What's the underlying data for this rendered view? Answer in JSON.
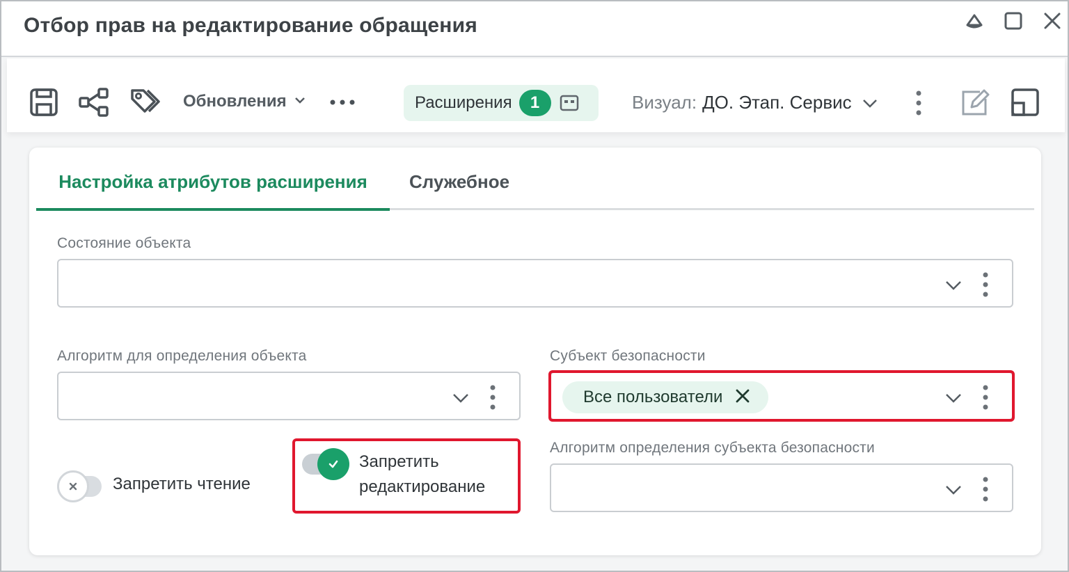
{
  "window": {
    "title": "Отбор прав на редактирование обращения",
    "controls": [
      "collapse-icon",
      "maximize-icon",
      "close-icon"
    ]
  },
  "toolbar": {
    "icons": [
      "save-icon",
      "share-icon",
      "tags-icon"
    ],
    "updates_label": "Обновления",
    "more_icon": "more-horizontal-icon",
    "extensions_label": "Расширения",
    "extensions_count": "1",
    "visual_label": "Визуал:",
    "visual_value": "ДО. Этап. Сервис",
    "right_icons": [
      "more-vertical-icon",
      "edit-icon",
      "layout-icon"
    ]
  },
  "tabs": [
    {
      "label": "Настройка атрибутов расширения",
      "active": true
    },
    {
      "label": "Служебное",
      "active": false
    }
  ],
  "form": {
    "object_state": {
      "label": "Состояние объекта",
      "value": ""
    },
    "object_algorithm": {
      "label": "Алгоритм для определения объекта",
      "value": ""
    },
    "security_subject": {
      "label": "Субъект безопасности",
      "chips": [
        "Все пользователи"
      ]
    },
    "security_subject_algorithm": {
      "label": "Алгоритм определения субъекта безопасности",
      "value": ""
    },
    "deny_read": {
      "label": "Запретить чтение",
      "on": false
    },
    "deny_edit": {
      "label_line1": "Запретить",
      "label_line2": "редактирование",
      "on": true
    }
  },
  "colors": {
    "accent": "#1c8a5e",
    "badge": "#1aa06a",
    "chip_bg": "#e6f5ee",
    "highlight": "#e0172e"
  }
}
